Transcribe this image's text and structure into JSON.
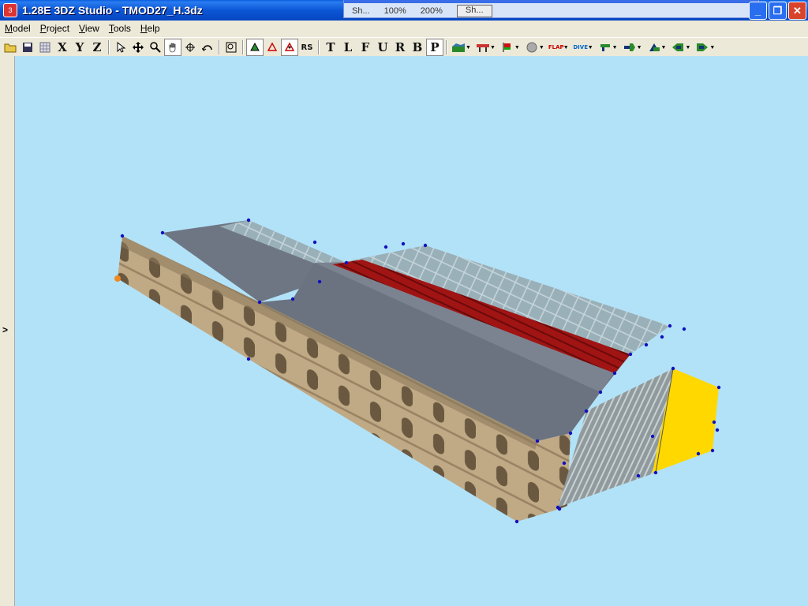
{
  "window": {
    "title": "1.28E 3DZ Studio - TMOD27_H.3dz"
  },
  "background_window": {
    "text1": "Sh...",
    "text2": "100%",
    "text3": "200%",
    "button": "Sh..."
  },
  "menu": [
    {
      "label": "Model",
      "key": "M"
    },
    {
      "label": "Project",
      "key": "P"
    },
    {
      "label": "View",
      "key": "V"
    },
    {
      "label": "Tools",
      "key": "T"
    },
    {
      "label": "Help",
      "key": "H"
    }
  ],
  "toolbar": {
    "axis_x": "X",
    "axis_y": "Y",
    "axis_z": "Z",
    "view_letters": [
      "T",
      "L",
      "F",
      "U",
      "R",
      "B",
      "P"
    ],
    "active_view": "P",
    "rs_label": "RS",
    "flap_label": "FLAP",
    "dive_label": "DIVE"
  },
  "colors": {
    "viewport_bg": "#b2e2f8",
    "roof": "#6e7684",
    "wall": "#b8a27e",
    "red_strip": "#a01414",
    "yellow": "#ffd800",
    "vertex": "#1010c0"
  }
}
